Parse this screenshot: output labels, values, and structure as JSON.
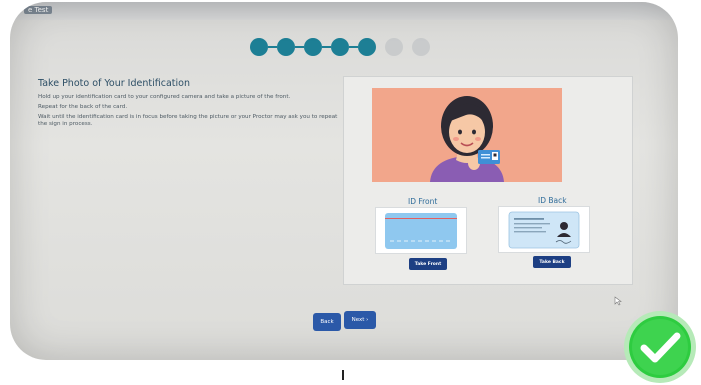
{
  "window": {
    "title": "e Test"
  },
  "steps": {
    "total": 7,
    "completed": 5
  },
  "instructions": {
    "title": "Take Photo of Your Identification",
    "paragraphs": [
      "Hold up your identification card to your configured camera and take a picture of the front.",
      "Repeat for the back of the card.",
      "Wait until the identification card is in focus before taking the picture or your Proctor may ask you to repeat the sign in process."
    ]
  },
  "cards": {
    "front_label": "ID Front",
    "back_label": "ID Back",
    "take_front_label": "Take Front",
    "take_back_label": "Take Back"
  },
  "navigation": {
    "back_label": "Back",
    "next_label": "Next ›"
  },
  "colors": {
    "accent": "#1d7f95",
    "button": "#1d3f83",
    "nav_button": "#2b59a8",
    "photo_bg": "#f2a68b",
    "success": "#2ecc40"
  },
  "icons": {
    "status": "check-circle-icon"
  }
}
